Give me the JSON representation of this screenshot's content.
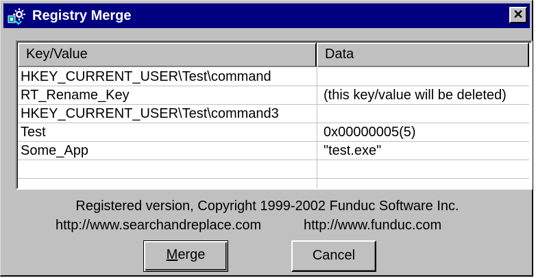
{
  "window": {
    "title": "Registry Merge",
    "close_glyph": "✕",
    "icon": "registry-app-icon",
    "title_bg": "#000080"
  },
  "table": {
    "columns": [
      "Key/Value",
      "Data"
    ],
    "rows": [
      {
        "key": "HKEY_CURRENT_USER\\Test\\command",
        "data": ""
      },
      {
        "key": "RT_Rename_Key",
        "data": "(this key/value will be deleted)"
      },
      {
        "key": "HKEY_CURRENT_USER\\Test\\command3",
        "data": ""
      },
      {
        "key": "Test",
        "data": "0x00000005(5)"
      },
      {
        "key": "Some_App",
        "data": "\"test.exe\""
      },
      {
        "key": "",
        "data": ""
      }
    ]
  },
  "footer": {
    "copyright": "Registered version, Copyright 1999-2002 Funduc Software Inc.",
    "url_left": "http://www.searchandreplace.com",
    "url_right": "http://www.funduc.com"
  },
  "buttons": {
    "merge_mnemonic": "M",
    "merge_rest": "erge",
    "cancel": "Cancel"
  }
}
